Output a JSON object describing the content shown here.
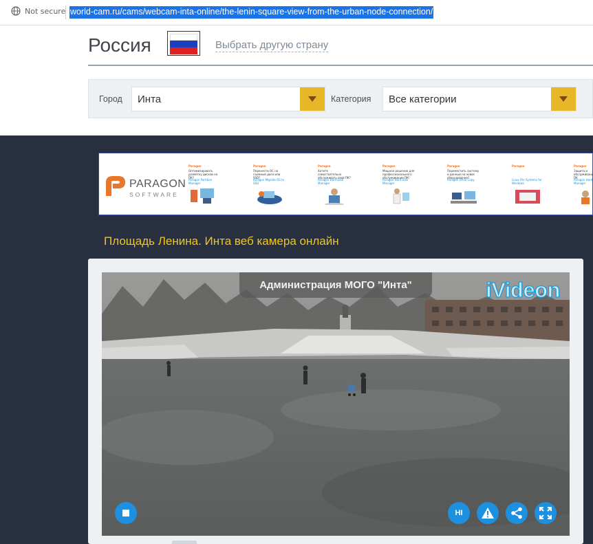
{
  "browser": {
    "security_label": "Not secure",
    "url": "world-cam.ru/cams/webcam-inta-online/the-lenin-square-view-from-the-urban-node-connection/"
  },
  "header": {
    "country": "Россия",
    "change_country": "Выбрать другую страну",
    "flag_colors": [
      "#ffffff",
      "#1c3fbf",
      "#e02020"
    ]
  },
  "filters": {
    "city_label": "Город",
    "city_value": "Инта",
    "category_label": "Категория",
    "category_value": "Все категории",
    "arrow_color": "#e7b727"
  },
  "ad_banner": {
    "brand": "PARAGON",
    "brand_sub": "SOFTWARE",
    "items": [
      {
        "icon": "paragon-icon",
        "heading": "Paragon",
        "text": "Оптимизировать разметку дисков на ПК?",
        "link": "Paragon Partition Manager"
      },
      {
        "icon": "paragon-icon",
        "heading": "Paragon",
        "text": "Перенести ОС на съемный диск или SSD?",
        "link": "Paragon Migrate OS to SSD"
      },
      {
        "icon": "paragon-icon",
        "heading": "Paragon",
        "text": "Хотите самостоятельно обслуживать свой ПК?",
        "link": "Paragon Hard Disk Manager"
      },
      {
        "icon": "paragon-icon",
        "heading": "Paragon",
        "text": "Мощное решение для профессионального обслуживания ПК!",
        "link": "Paragon Hard Disk Manager"
      },
      {
        "icon": "paragon-icon",
        "heading": "Paragon",
        "text": "Переместить систему и данные на новое оборудование?",
        "link": "Paragon Drive Copy"
      },
      {
        "icon": "paragon-icon",
        "heading": "Paragon",
        "text": "",
        "link": "Linux File Systems for Windows"
      },
      {
        "icon": "paragon-icon",
        "heading": "Paragon",
        "text": "Защита и обслуживание ваших ПК",
        "link": "Paragon Hard Disk Manager"
      }
    ]
  },
  "page_title": "Площадь Ленина. Инта веб камера онлайн",
  "player": {
    "camera_name": "Администрация МОГО \"Инта\"",
    "brand": "iVideon",
    "buttons": {
      "stop": "stop-icon",
      "quality": "HI",
      "report": "warning-icon",
      "share": "share-icon",
      "fullscreen": "fullscreen-icon"
    },
    "accent_color": "#1e90e0"
  }
}
